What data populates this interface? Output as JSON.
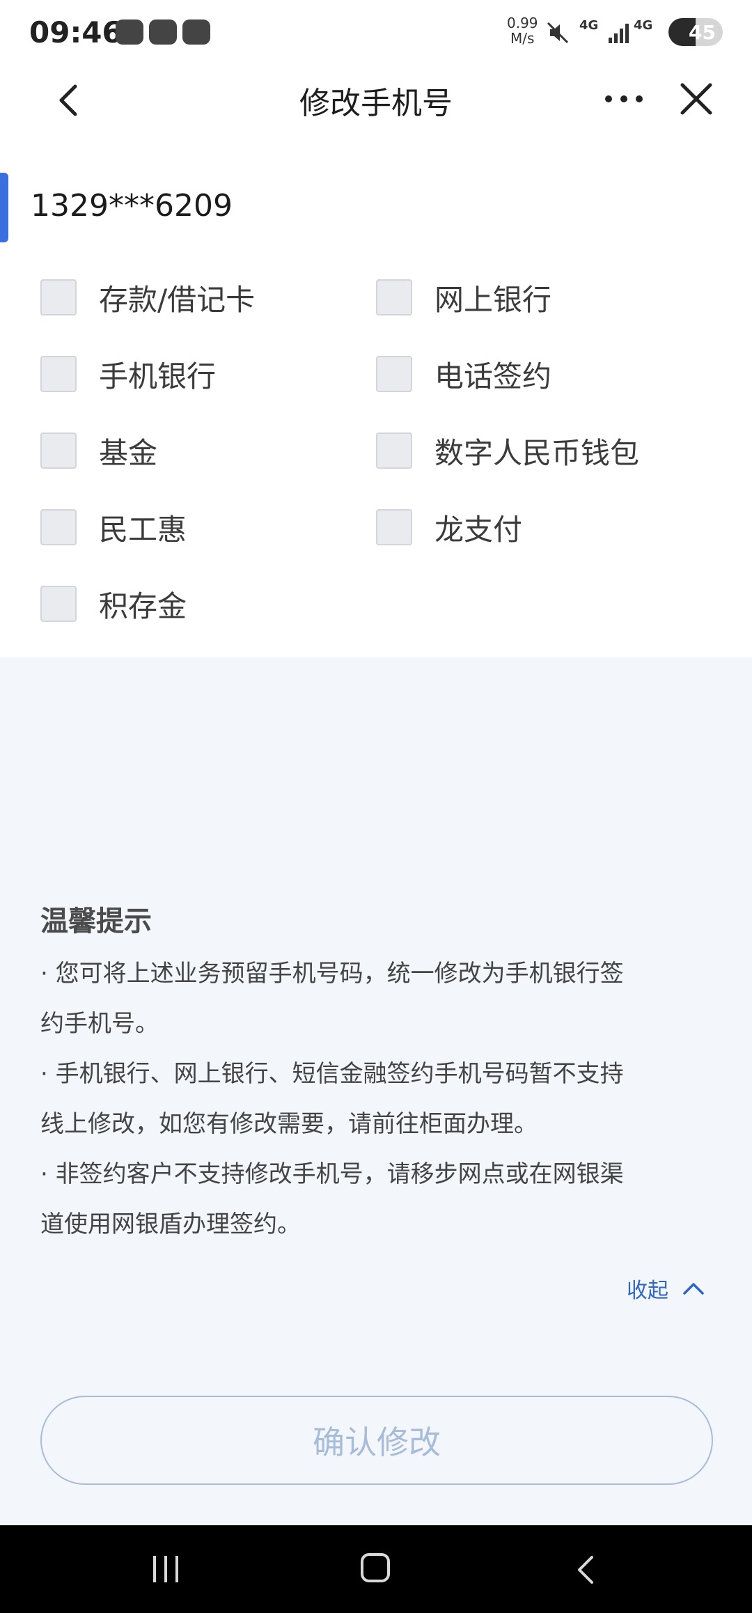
{
  "status_bar": {
    "time": "09:46",
    "speed_value": "0.99",
    "speed_unit": "M/s",
    "network1": "4G",
    "network2": "4G",
    "battery": "45",
    "icons": [
      "wechat-icon",
      "message-icon",
      "task-icon",
      "mute-icon",
      "signal-icon",
      "battery-icon"
    ]
  },
  "header": {
    "title": "修改手机号"
  },
  "account": {
    "phone": "1329***6209"
  },
  "options": [
    {
      "label": "存款/借记卡",
      "checked": false
    },
    {
      "label": "网上银行",
      "checked": false
    },
    {
      "label": "手机银行",
      "checked": false
    },
    {
      "label": "电话签约",
      "checked": false
    },
    {
      "label": "基金",
      "checked": false
    },
    {
      "label": "数字人民币钱包",
      "checked": false
    },
    {
      "label": "民工惠",
      "checked": false
    },
    {
      "label": "龙支付",
      "checked": false
    },
    {
      "label": "积存金",
      "checked": false
    }
  ],
  "tips": {
    "title": "温馨提示",
    "lines": [
      "· 您可将上述业务预留手机号码，统一修改为手机银行签",
      "约手机号。",
      "· 手机银行、网上银行、短信金融签约手机号码暂不支持",
      "线上修改，如您有修改需要，请前往柜面办理。",
      "· 非签约客户不支持修改手机号，请移步网点或在网银渠",
      "道使用网银盾办理签约。"
    ],
    "collapse_label": "收起"
  },
  "actions": {
    "confirm_label": "确认修改"
  },
  "colors": {
    "accent": "#3b6fe0",
    "link": "#2f66c8",
    "button_disabled": "#a7bcd9",
    "page_bg": "#f3f6fa"
  }
}
